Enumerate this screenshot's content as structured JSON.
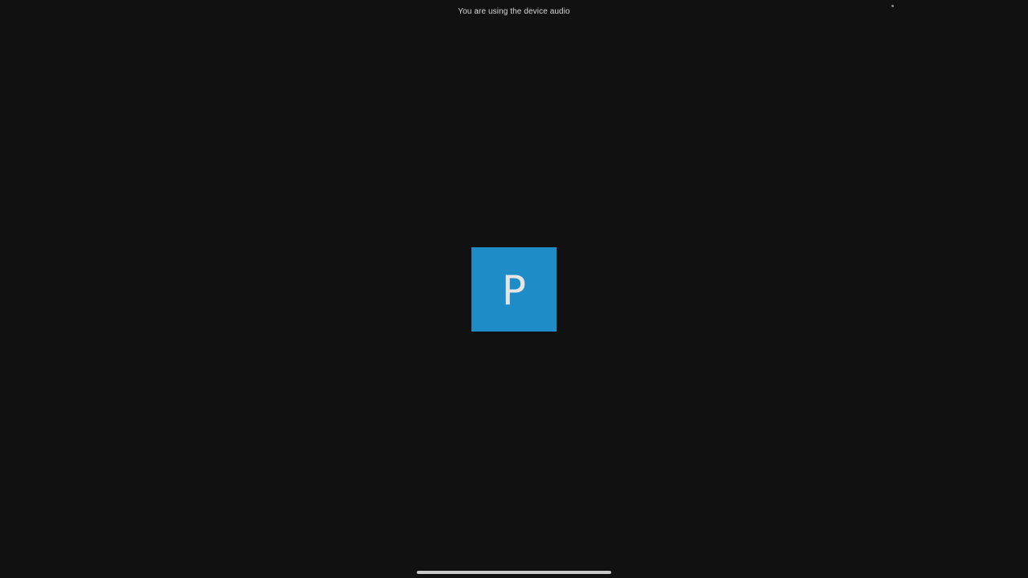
{
  "status_bar": {
    "audio_message": "You are using the device audio"
  },
  "participant": {
    "initial": "P",
    "avatar_color": "#1e8cc6"
  },
  "background_color": "#111111"
}
